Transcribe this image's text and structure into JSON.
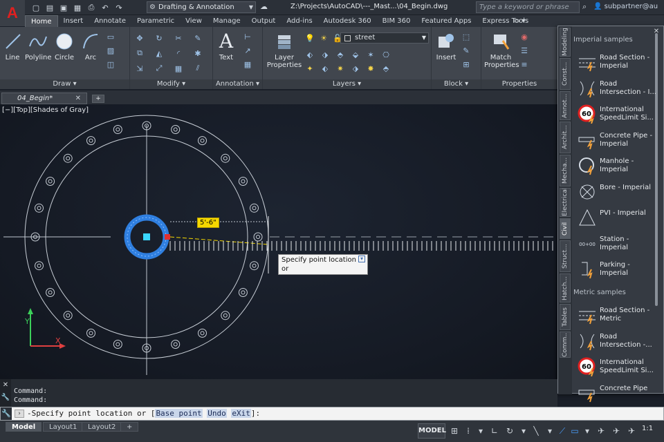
{
  "titlebar": {
    "workspace": "Drafting & Annotation",
    "document": "Z:\\Projects\\AutoCAD\\---_Mast...\\04_Begin.dwg",
    "search_placeholder": "Type a keyword or phrase",
    "user": "subpartner@au"
  },
  "ribbon": {
    "tabs": [
      "Home",
      "Insert",
      "Annotate",
      "Parametric",
      "View",
      "Manage",
      "Output",
      "Add-ins",
      "Autodesk 360",
      "BIM 360",
      "Featured Apps",
      "Express Tools"
    ],
    "active_tab": "Home",
    "draw": {
      "title": "Draw",
      "line": "Line",
      "polyline": "Polyline",
      "circle": "Circle",
      "arc": "Arc"
    },
    "modify": {
      "title": "Modify"
    },
    "annotation": {
      "title": "Annotation",
      "text": "Text"
    },
    "layers": {
      "title": "Layers",
      "layer_properties": "Layer\nProperties",
      "current_layer": "street"
    },
    "block": {
      "title": "Block",
      "insert": "Insert"
    },
    "properties": {
      "title": "Properties",
      "match_properties": "Match\nProperties"
    }
  },
  "doctabs": {
    "active": "04_Begin*"
  },
  "canvas": {
    "viewport_label": "[−][Top][Shades of Gray]",
    "dimension_value": "5'-6\"",
    "tooltip": "Specify point location or"
  },
  "palette": {
    "tabs": [
      "Modeling",
      "Const...",
      "Annot...",
      "Archit...",
      "Mecha...",
      "Electrical",
      "Civil",
      "Struct...",
      "Hatch...",
      "Tables",
      "Comm..."
    ],
    "active_tab": "Civil",
    "imperial_title": "Imperial samples",
    "metric_title": "Metric samples",
    "imperial_items": [
      "Road Section -\nImperial",
      "Road\nIntersection - I...",
      "International\nSpeedLimit Si...",
      "Concrete Pipe -\nImperial",
      "Manhole -\nImperial",
      "Bore - Imperial",
      "PVI - Imperial",
      "Station -\nImperial",
      "Parking -\nImperial"
    ],
    "metric_items": [
      "Road Section -\nMetric",
      "Road\nIntersection -...",
      "International\nSpeedLimit Si...",
      "Concrete Pipe"
    ],
    "speed_sign_value": "60",
    "station_glyph": "00+00"
  },
  "command": {
    "history": [
      "Command:",
      "Command:"
    ],
    "prompt_prefix": "-Specify point location or [",
    "options": [
      "Base point",
      "Undo",
      "eXit"
    ],
    "prompt_suffix": "]:"
  },
  "statusbar": {
    "layouts": [
      "Model",
      "Layout1",
      "Layout2"
    ],
    "active_layout": "Model",
    "model_button": "MODEL",
    "scale": "1:1"
  },
  "colors": {
    "accent_blue": "#2f7fe0",
    "dimension_box": "#f5d800",
    "app_red": "#e02020"
  }
}
